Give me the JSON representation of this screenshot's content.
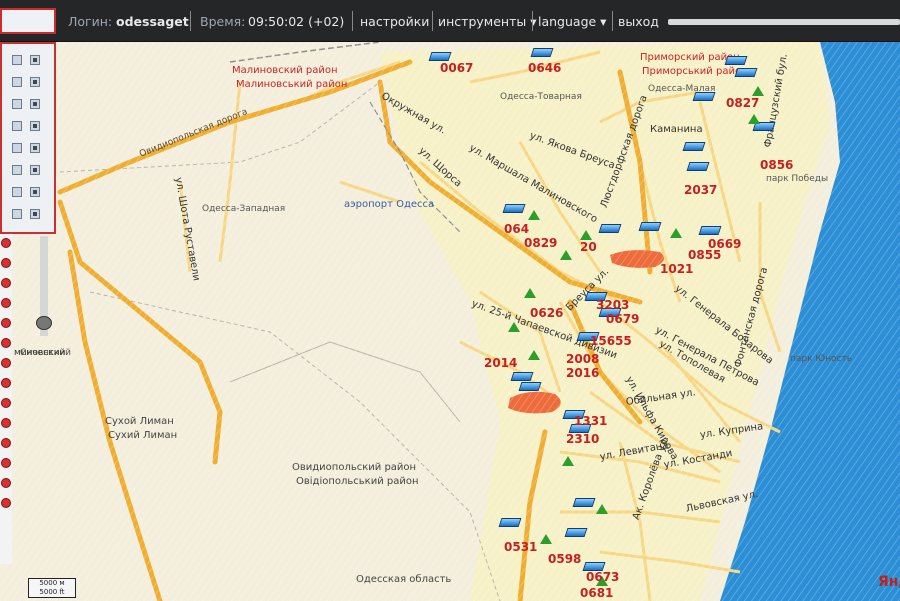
{
  "topbar": {
    "login_label": "Логин:",
    "login_value": "odessaget",
    "time_label": "Время:",
    "time_value": "09:50:02 (+02)",
    "menu": [
      "настройки",
      "инструменты ▾",
      "language ▾",
      "выход"
    ]
  },
  "map": {
    "district_labels": [
      {
        "text": "Малиновский район"
      },
      {
        "text": "Малиновський район"
      },
      {
        "text": "Приморский район"
      },
      {
        "text": "Приморський район"
      }
    ],
    "area_labels": [
      {
        "text": "Сухой Лиман"
      },
      {
        "text": "Сухий Лиман"
      },
      {
        "text": "Овидиопольский район"
      },
      {
        "text": "Овідіопольський район"
      },
      {
        "text": "Одесская область"
      },
      {
        "text": "аэропорт Одесса"
      },
      {
        "text": "Одесса-Западная"
      },
      {
        "text": "Одесса-Малая"
      },
      {
        "text": "Одесса-Товарная"
      },
      {
        "text": "парк Победы"
      },
      {
        "text": "парк Юность"
      },
      {
        "text": "Сиченский"
      }
    ],
    "street_labels": [
      {
        "text": "Овидиопольская дорога"
      },
      {
        "text": "ул. Шота Руставели"
      },
      {
        "text": "Окружная ул."
      },
      {
        "text": "ул. Маршала Малиновского"
      },
      {
        "text": "ул. Щорса"
      },
      {
        "text": "ул. Якова Бреуса"
      },
      {
        "text": "Люстдорфская дорога"
      },
      {
        "text": "ул. Генерала Петрова"
      },
      {
        "text": "ул. Генерала Бочарова"
      },
      {
        "text": "ул. Тополевая"
      },
      {
        "text": "ул. Ильфа Кирова"
      },
      {
        "text": "Обильная ул."
      },
      {
        "text": "ул. Куприна"
      },
      {
        "text": "ул. Левитана"
      },
      {
        "text": "ул. Костанди"
      },
      {
        "text": "Львовская ул."
      },
      {
        "text": "Фонтанская дорога"
      },
      {
        "text": "Французский бул."
      },
      {
        "text": "ул. 25-й Чапаевской дивизии"
      },
      {
        "text": "Бреуса ул."
      },
      {
        "text": "Каманина"
      },
      {
        "text": "Ак. Королёва ул."
      }
    ],
    "vehicle_numbers": [
      {
        "text": "0067"
      },
      {
        "text": "0646"
      },
      {
        "text": "0827"
      },
      {
        "text": "0856"
      },
      {
        "text": "2037"
      },
      {
        "text": "0669"
      },
      {
        "text": "0855"
      },
      {
        "text": "064"
      },
      {
        "text": "0829"
      },
      {
        "text": "20"
      },
      {
        "text": "3203"
      },
      {
        "text": "0626"
      },
      {
        "text": "0679"
      },
      {
        "text": "15655"
      },
      {
        "text": "2014"
      },
      {
        "text": "2008"
      },
      {
        "text": "2016"
      },
      {
        "text": "1331"
      },
      {
        "text": "2310"
      },
      {
        "text": "0531"
      },
      {
        "text": "0598"
      },
      {
        "text": "0681"
      },
      {
        "text": "0673"
      },
      {
        "text": "1021"
      }
    ],
    "scale_bar": [
      "5000 м",
      "5000 ft"
    ],
    "brand": "Янд",
    "sidebar_partial_label": "миновский"
  },
  "colors": {
    "topbar_bg": "#242628",
    "map_land": "#f5efd9",
    "road_major": "#f0b33a",
    "road_minor": "#f7dd87",
    "sea": "#2c8fd6",
    "vehicle_number": "#c71f1f",
    "panel_border": "#c93131"
  }
}
